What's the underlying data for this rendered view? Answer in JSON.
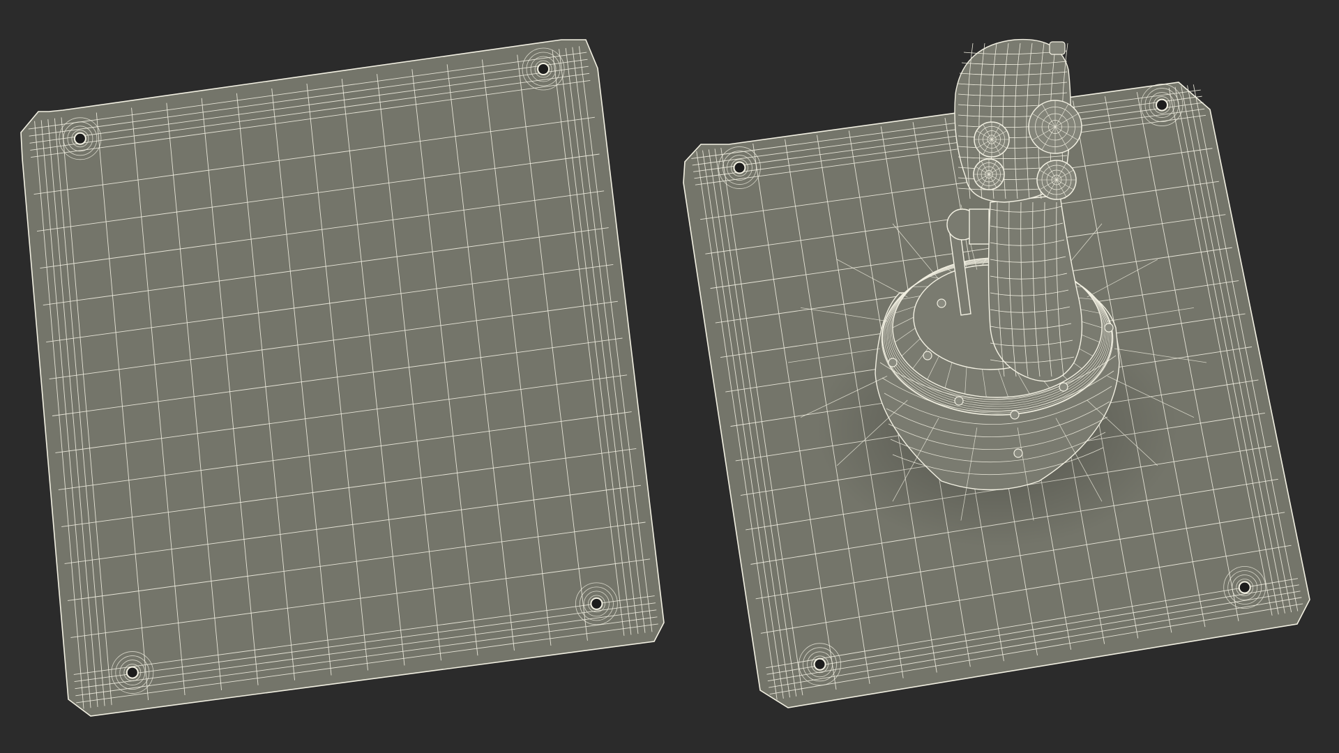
{
  "scene": {
    "background_color": "#2b2b2b",
    "plate_fill": "#74756a",
    "wire_color": "#f3f1e3",
    "hole_color": "#1d1d1d",
    "views": [
      {
        "name": "plate-only",
        "contains_joystick": false,
        "mounting_holes": 4
      },
      {
        "name": "plate-with-joystick",
        "contains_joystick": true,
        "mounting_holes": 4
      }
    ]
  }
}
